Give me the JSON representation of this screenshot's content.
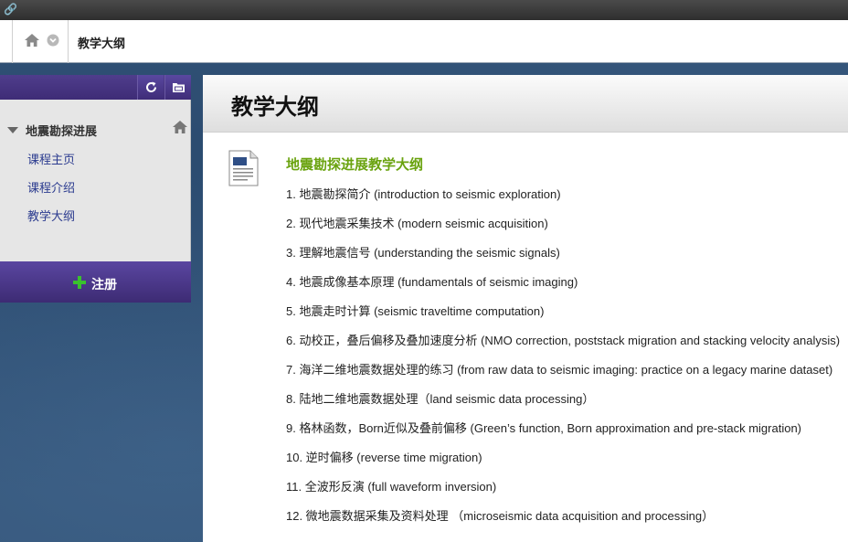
{
  "topbar": {
    "icon": "link-icon"
  },
  "breadcrumb": {
    "home_icon": "home-icon",
    "menu_icon": "chevron-down-circle-icon",
    "title": "教学大纲"
  },
  "sidebar": {
    "header_buttons": [
      {
        "icon": "refresh-icon"
      },
      {
        "icon": "folder-icon"
      }
    ],
    "course_title": "地震勘探进展",
    "items": [
      {
        "label": "课程主页"
      },
      {
        "label": "课程介绍"
      },
      {
        "label": "教学大纲"
      }
    ],
    "register_label": "注册",
    "register_icon": "plus-icon"
  },
  "main": {
    "title": "教学大纲",
    "doc_icon": "document-icon",
    "doc_title": "地震勘探进展教学大纲",
    "outline": [
      "1. 地震勘探简介 (introduction to seismic exploration)",
      "2. 现代地震采集技术 (modern seismic acquisition)",
      "3. 理解地震信号 (understanding the seismic signals)",
      "4. 地震成像基本原理 (fundamentals of seismic imaging)",
      "5. 地震走时计算 (seismic traveltime computation)",
      "6. 动校正，叠后偏移及叠加速度分析 (NMO correction, poststack migration and stacking velocity analysis)",
      "7. 海洋二维地震数据处理的练习 (from raw data to seismic imaging: practice on a legacy marine dataset)",
      "8. 陆地二维地震数据处理（land seismic data processing）",
      "9. 格林函数，Born近似及叠前偏移 (Green’s function, Born approximation and pre-stack migration)",
      "10. 逆时偏移 (reverse time migration)",
      "11. 全波形反演 (full waveform inversion)",
      "12. 微地震数据采集及资料处理 （microseismic data acquisition and processing）"
    ]
  },
  "colors": {
    "sidebar_purple": "#4a3888",
    "link_blue": "#2b3b8f",
    "doc_title_green": "#6aa30f",
    "plus_green": "#39c22d",
    "background_blue": "#34557a"
  }
}
